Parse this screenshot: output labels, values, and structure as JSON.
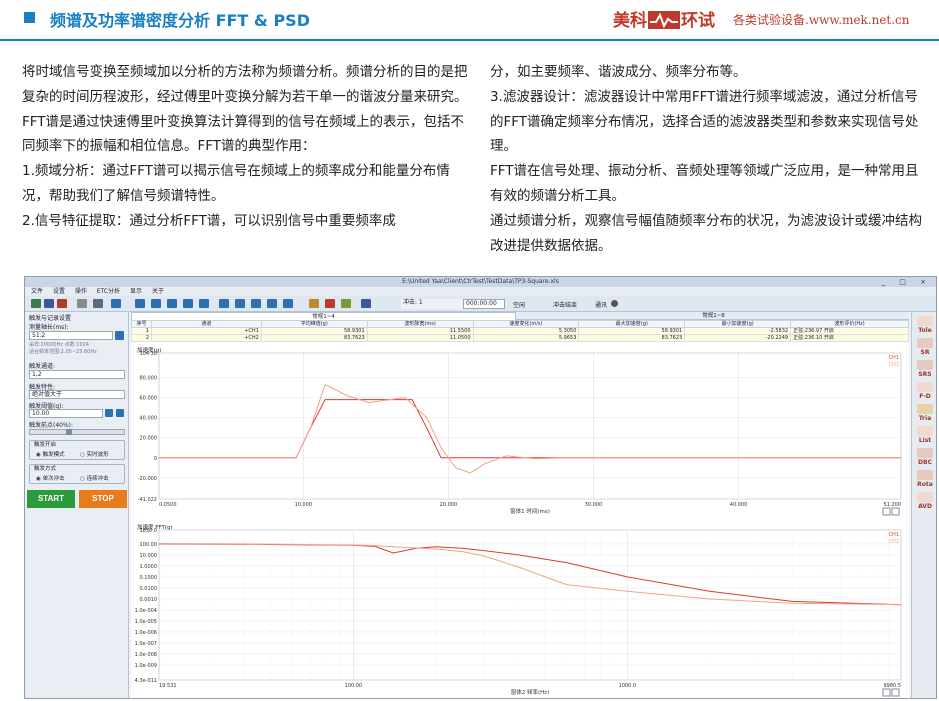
{
  "header": {
    "title": "频谱及功率谱密度分析 FFT & PSD",
    "brand": "美科",
    "brand2": "环试",
    "brand_sub": "各类试验设备.www.mek.net.cn",
    "accent": "#1b7fc4",
    "brand_color": "#c0392b"
  },
  "article": {
    "left": [
      "将时域信号变换至频域加以分析的方法称为频谱分析。频谱分析的目的是把复杂的时间历程波形，经过傅里叶变换分解为若干单一的谐波分量来研究。",
      "FFT谱是通过快速傅里叶变换算法计算得到的信号在频域上的表示，包括不同频率下的振幅和相位信息。FFT谱的典型作用：",
      "1.频域分析：通过FFT谱可以揭示信号在频域上的频率成分和能量分布情况，帮助我们了解信号频谱特性。",
      "2.信号特征提取：通过分析FFT谱，可以识别信号中重要频率成"
    ],
    "right": [
      "分，如主要频率、谐波成分、频率分布等。",
      "3.滤波器设计：滤波器设计中常用FFT谱进行频率域滤波，通过分析信号的FFT谱确定频率分布情况，选择合适的滤波器类型和参数来实现信号处理。",
      "FFT谱在信号处理、振动分析、音频处理等领域广泛应用，是一种常用且有效的频谱分析工具。",
      "通过频谱分析，观察信号幅值随频率分布的状况，为滤波设计或缓冲结构改进提供数据依据。"
    ]
  },
  "window": {
    "title": "E:\\United Yaa\\Client\\CtrTest\\TestData\\TP3-Square.xls",
    "controls": "_ □ ×",
    "menu": [
      "文件",
      "设置",
      "操作",
      "ETC分析",
      "显示",
      "关于"
    ],
    "toolbar": {
      "shock_label": "冲击: 1",
      "time_value": "000:00:00",
      "idle": "空闲",
      "shock_end": "冲击结束",
      "comm": "通讯"
    },
    "left_panel": {
      "group_title": "触发与记录设置",
      "record_length_label": "测量轴长(ms):",
      "record_length": "51.2",
      "sample_info": "采样:20000Hz",
      "point_info": "点数:1024",
      "filter_info": "适合频率范围:2.05~25.60Hz",
      "trigger_channel_label": "触发通道:",
      "trigger_channel": "1,2",
      "trigger_condition_label": "触发特性:",
      "trigger_condition": "绝对值大于",
      "trigger_threshold_label": "触发阈值(g):",
      "trigger_threshold": "10.00",
      "pretrigger_label": "触发前点(40%):",
      "trigger_on_title": "触发开启",
      "trigger_mode": "触发模式",
      "realtime": "实时波形",
      "trigger_way_title": "触发方式",
      "single": "单次冲击",
      "continuous": "连续冲击",
      "start": "START",
      "stop": "STOP"
    },
    "tabs": [
      "常规1~4",
      "常规1~8"
    ],
    "table": {
      "headers": [
        "序号",
        "通道",
        "平均峰值(g)",
        "波形脉宽(ms)",
        "速度变化(m/s)",
        "最大加速度(g)",
        "最小加速度(g)",
        "波形评价(Hz)"
      ],
      "rows": [
        [
          "1",
          "+CH1",
          "58.9301",
          "11.5500",
          "5.3050",
          "58.9301",
          "-2.5832",
          "正弦:236.97 开启"
        ],
        [
          "2",
          "+CH2",
          "83.7623",
          "11.0500",
          "5.9653",
          "83.7623",
          "-20.2249",
          "正弦:236.10 开启"
        ]
      ]
    },
    "right_panel": [
      "Tole",
      "SR",
      "SRS",
      "F-D",
      "Tria",
      "List",
      "DBC",
      "Rota",
      "AVD"
    ]
  },
  "chart_data": [
    {
      "type": "line",
      "ylabel": "加速度(g)",
      "xlabel": "窗体1 时间(ms)",
      "xlim": [
        0.05,
        51.2
      ],
      "ylim": [
        -41.022,
        104.36
      ],
      "x_ticks": [
        0.05,
        10.0,
        20.0,
        30.0,
        40.0,
        51.2
      ],
      "x_tick_labels": [
        "0.0500",
        "10.000",
        "20.000",
        "30.000",
        "40.000",
        "51.200"
      ],
      "y_ticks": [
        104.36,
        80.0,
        60.0,
        40.0,
        20.0,
        0,
        -20.0,
        -41.022
      ],
      "y_tick_labels": [
        "104.36",
        "80.000",
        "60.000",
        "40.000",
        "20.000",
        "0",
        "-20.000",
        "-41.022"
      ],
      "legend": [
        "CH1",
        "CH2"
      ],
      "legend_position": "top-right",
      "series": [
        {
          "name": "CH1",
          "color": "#e0392b",
          "x": [
            0.05,
            7.0,
            9.5,
            10.5,
            11.5,
            16.5,
            17.5,
            18.5,
            19.5,
            22.0,
            51.2
          ],
          "y": [
            0,
            0,
            0,
            30,
            58,
            58,
            58,
            30,
            0,
            0,
            0
          ]
        },
        {
          "name": "CH2",
          "color": "#f4a08a",
          "x": [
            0.05,
            7.0,
            9.5,
            10.5,
            11.5,
            13.0,
            14.5,
            15.5,
            17.0,
            18.5,
            19.5,
            20.5,
            21.5,
            22.5,
            24.0,
            26.0,
            28.0,
            51.2
          ],
          "y": [
            0,
            0,
            0,
            30,
            73,
            62,
            55,
            57,
            60,
            40,
            10,
            -10,
            -15,
            -6,
            2,
            -1,
            0,
            0
          ]
        }
      ]
    },
    {
      "type": "line",
      "ylabel": "加速度 FFT(g)",
      "xlabel": "窗体2 频率(Hz)",
      "xscale": "log",
      "xlim": [
        19.531,
        9980.5
      ],
      "x_ticks": [
        19.531,
        100.0,
        1000.0,
        9980.5
      ],
      "x_tick_labels": [
        "19.531",
        "100.00",
        "1000.0",
        "9980.5"
      ],
      "y_tick_labels": [
        "1850.0",
        "100.00",
        "10.000",
        "1.0000",
        "0.1000",
        "0.0100",
        "0.0010",
        "1.0e-004",
        "1.0e-005",
        "1.0e-006",
        "1.0e-007",
        "1.0e-008",
        "1.0e-009",
        "4.3e-011"
      ],
      "legend": [
        "CH1",
        "CH2"
      ],
      "legend_position": "top-right",
      "series": [
        {
          "name": "CH1",
          "color": "#e0392b",
          "x": [
            19.531,
            40,
            60,
            80,
            100,
            120,
            140,
            170,
            200,
            250,
            300,
            400,
            600,
            1000,
            2000,
            4000,
            9980.5
          ],
          "y": [
            100,
            95,
            85,
            80,
            75,
            60,
            15,
            40,
            55,
            40,
            25,
            10,
            2,
            0.1,
            0.005,
            0.0006,
            0.0003
          ]
        },
        {
          "name": "CH2",
          "color": "#f4a08a",
          "x": [
            19.531,
            40,
            60,
            80,
            100,
            120,
            150,
            200,
            250,
            300,
            400,
            600,
            1000,
            2000,
            4000,
            9980.5
          ],
          "y": [
            110,
            100,
            90,
            85,
            80,
            70,
            50,
            35,
            20,
            8,
            0.8,
            0.02,
            0.005,
            0.001,
            0.0004,
            0.0003
          ]
        }
      ]
    }
  ]
}
